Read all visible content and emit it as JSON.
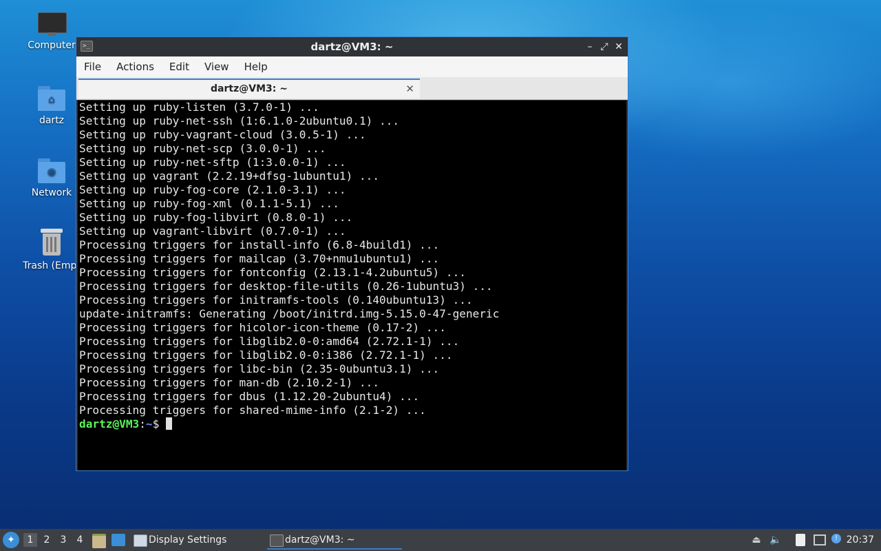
{
  "desktop": {
    "icons": [
      {
        "label": "Computer"
      },
      {
        "label": "dartz"
      },
      {
        "label": "Network"
      },
      {
        "label": "Trash (Empt"
      }
    ]
  },
  "window": {
    "title": "dartz@VM3: ~",
    "controls": {
      "minimize": "–",
      "maximize": "⤢",
      "close": "✕"
    },
    "menu": [
      "File",
      "Actions",
      "Edit",
      "View",
      "Help"
    ],
    "tab": {
      "label": "dartz@VM3: ~",
      "close": "✕"
    }
  },
  "terminal": {
    "lines": [
      "Setting up ruby-listen (3.7.0-1) ...",
      "Setting up ruby-net-ssh (1:6.1.0-2ubuntu0.1) ...",
      "Setting up ruby-vagrant-cloud (3.0.5-1) ...",
      "Setting up ruby-net-scp (3.0.0-1) ...",
      "Setting up ruby-net-sftp (1:3.0.0-1) ...",
      "Setting up vagrant (2.2.19+dfsg-1ubuntu1) ...",
      "Setting up ruby-fog-core (2.1.0-3.1) ...",
      "Setting up ruby-fog-xml (0.1.1-5.1) ...",
      "Setting up ruby-fog-libvirt (0.8.0-1) ...",
      "Setting up vagrant-libvirt (0.7.0-1) ...",
      "Processing triggers for install-info (6.8-4build1) ...",
      "Processing triggers for mailcap (3.70+nmu1ubuntu1) ...",
      "Processing triggers for fontconfig (2.13.1-4.2ubuntu5) ...",
      "Processing triggers for desktop-file-utils (0.26-1ubuntu3) ...",
      "Processing triggers for initramfs-tools (0.140ubuntu13) ...",
      "update-initramfs: Generating /boot/initrd.img-5.15.0-47-generic",
      "Processing triggers for hicolor-icon-theme (0.17-2) ...",
      "Processing triggers for libglib2.0-0:amd64 (2.72.1-1) ...",
      "Processing triggers for libglib2.0-0:i386 (2.72.1-1) ...",
      "Processing triggers for libc-bin (2.35-0ubuntu3.1) ...",
      "Processing triggers for man-db (2.10.2-1) ...",
      "Processing triggers for dbus (1.12.20-2ubuntu4) ...",
      "Processing triggers for shared-mime-info (2.1-2) ..."
    ],
    "prompt": {
      "user_host": "dartz@VM3",
      "sep": ":",
      "path": "~",
      "symbol": "$ "
    }
  },
  "taskbar": {
    "workspaces": [
      "1",
      "2",
      "3",
      "4"
    ],
    "tasks": [
      {
        "label": "Display Settings"
      },
      {
        "label": "dartz@VM3: ~"
      }
    ],
    "clock": "20:37"
  }
}
